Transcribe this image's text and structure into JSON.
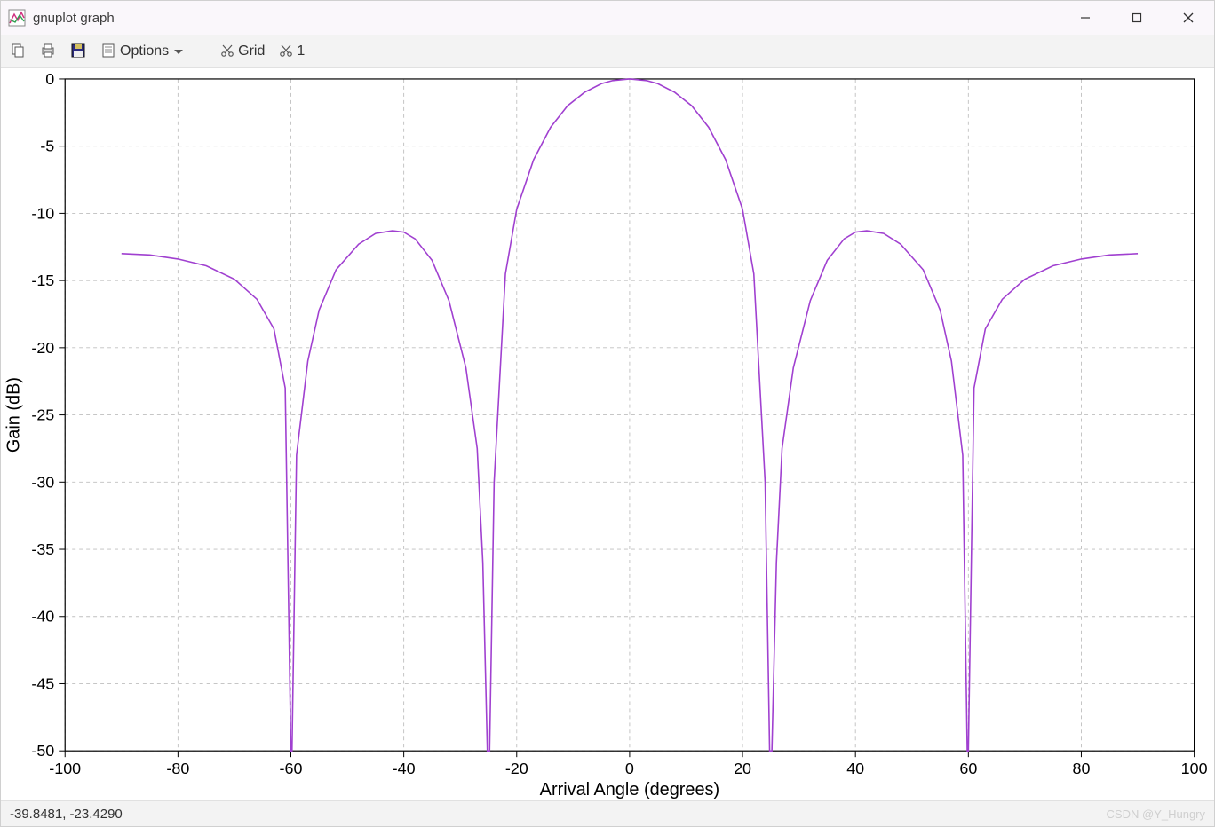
{
  "window": {
    "title": "gnuplot graph"
  },
  "toolbar": {
    "copy_tip": "Copy",
    "print_tip": "Print",
    "save_tip": "Save",
    "report_tip": "Report",
    "options_label": "Options",
    "grid_label": "Grid",
    "one_label": "1"
  },
  "status": {
    "coords": "-39.8481, -23.4290",
    "watermark": "CSDN @Y_Hungry"
  },
  "chart_data": {
    "type": "line",
    "xlabel": "Arrival Angle (degrees)",
    "ylabel": "Gain (dB)",
    "xlim": [
      -100,
      100
    ],
    "ylim": [
      -50,
      0
    ],
    "xticks": [
      -100,
      -80,
      -60,
      -40,
      -20,
      0,
      20,
      40,
      60,
      80,
      100
    ],
    "yticks": [
      0,
      -5,
      -10,
      -15,
      -20,
      -25,
      -30,
      -35,
      -40,
      -45,
      -50
    ],
    "color": "#a040d0",
    "grid": true,
    "series": [
      {
        "name": "gain",
        "x": [
          -90,
          -85,
          -80,
          -75,
          -70,
          -66,
          -63,
          -61,
          -60,
          -59.8,
          -59,
          -57,
          -55,
          -52,
          -48,
          -45,
          -42,
          -40,
          -38,
          -35,
          -32,
          -29,
          -27,
          -26,
          -25.2,
          -25,
          -24.8,
          -24,
          -22,
          -20,
          -17,
          -14,
          -11,
          -8,
          -5,
          -3,
          0,
          3,
          5,
          8,
          11,
          14,
          17,
          20,
          22,
          24,
          24.8,
          25,
          25.2,
          26,
          27,
          29,
          32,
          35,
          38,
          40,
          42,
          45,
          48,
          52,
          55,
          57,
          59,
          59.8,
          60,
          61,
          63,
          66,
          70,
          75,
          80,
          85,
          90
        ],
        "y": [
          -13.0,
          -13.1,
          -13.4,
          -13.9,
          -14.9,
          -16.4,
          -18.6,
          -23.0,
          -50,
          -50,
          -28,
          -21,
          -17.2,
          -14.2,
          -12.3,
          -11.5,
          -11.3,
          -11.4,
          -11.9,
          -13.5,
          -16.5,
          -21.5,
          -27.5,
          -36,
          -50,
          -50,
          -50,
          -30,
          -14.5,
          -9.7,
          -6.0,
          -3.6,
          -2.0,
          -1.0,
          -0.35,
          -0.12,
          0.0,
          -0.12,
          -0.35,
          -1.0,
          -2.0,
          -3.6,
          -6.0,
          -9.7,
          -14.5,
          -30,
          -50,
          -50,
          -50,
          -36,
          -27.5,
          -21.5,
          -16.5,
          -13.5,
          -11.9,
          -11.4,
          -11.3,
          -11.5,
          -12.3,
          -14.2,
          -17.2,
          -21,
          -28,
          -50,
          -50,
          -23.0,
          -18.6,
          -16.4,
          -14.9,
          -13.9,
          -13.4,
          -13.1,
          -13.0
        ]
      }
    ]
  }
}
